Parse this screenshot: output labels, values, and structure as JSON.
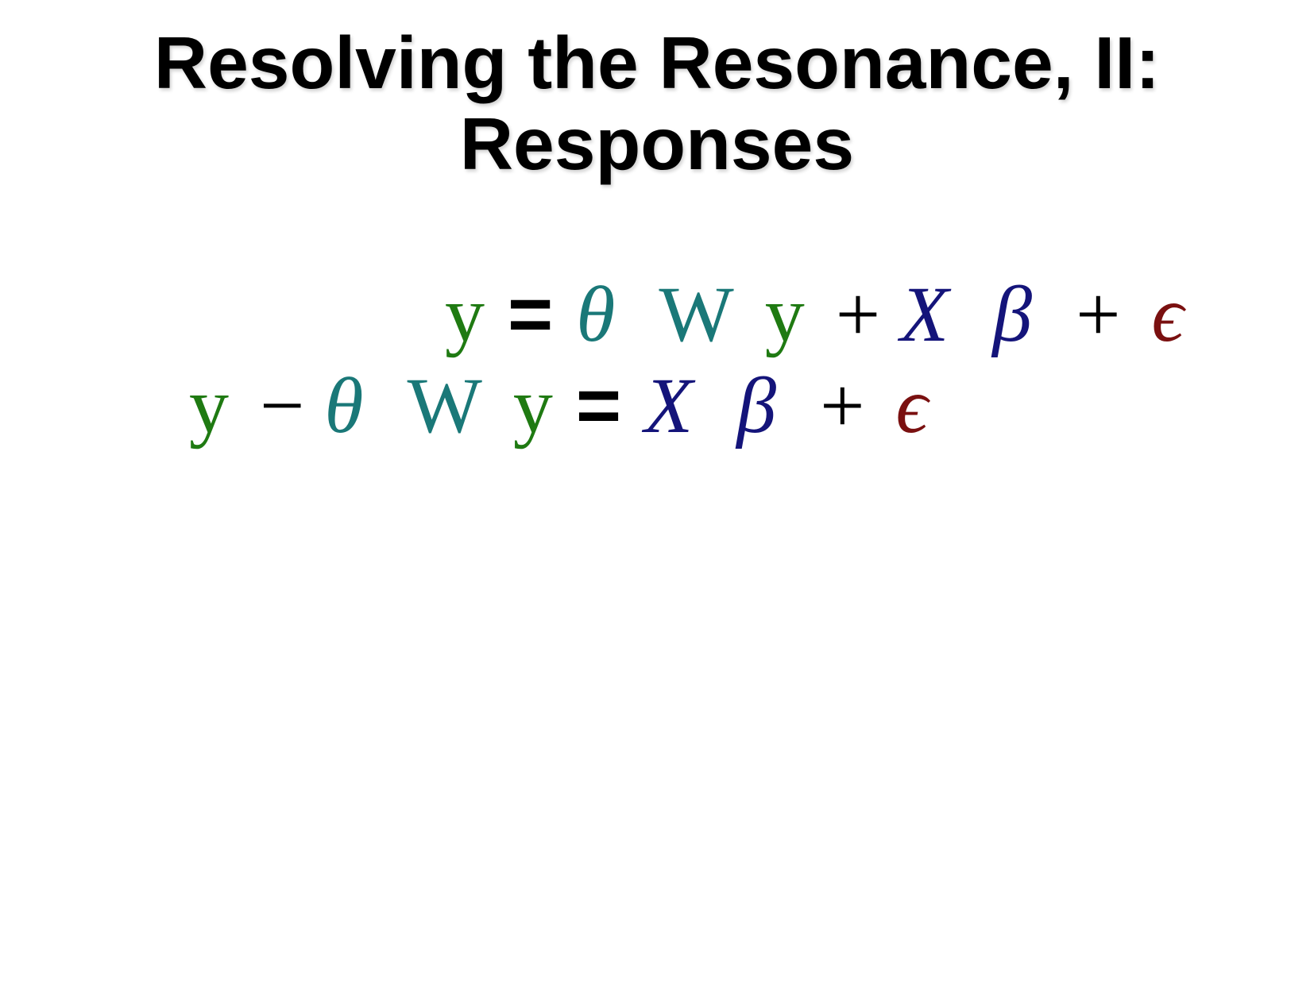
{
  "slide": {
    "title_line1": "Resolving the Resonance, II:",
    "title_line2": "Responses"
  },
  "equations": {
    "eq1": {
      "lhs_y": "y",
      "equals": "=",
      "theta": "θ",
      "W": "W",
      "y": "y",
      "plus1": "+",
      "X": "X",
      "beta": "β",
      "plus2": "+",
      "epsilon": "ϵ"
    },
    "eq2": {
      "y1": "y",
      "minus": "−",
      "theta": "θ",
      "W": "W",
      "y2": "y",
      "equals": "=",
      "X": "X",
      "beta": "β",
      "plus": "+",
      "epsilon": "ϵ"
    }
  },
  "colors": {
    "y": "#1f7a12",
    "theta_W": "#1a7878",
    "X_beta": "#14147a",
    "epsilon": "#7a1010",
    "operators": "#000000"
  }
}
